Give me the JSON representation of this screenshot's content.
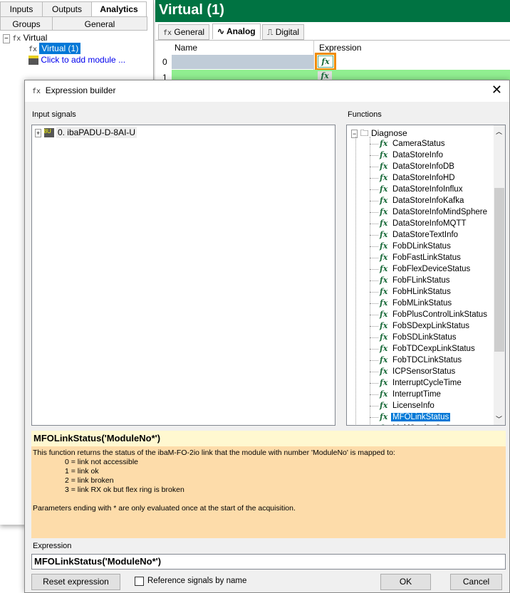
{
  "left_panel": {
    "tabs_row1": [
      "Inputs",
      "Outputs",
      "Analytics"
    ],
    "tabs_row2": [
      "Groups",
      "General"
    ],
    "tree": {
      "root": "Virtual",
      "child": "Virtual (1)",
      "add": "Click to add module ..."
    }
  },
  "right_panel": {
    "title": "Virtual (1)",
    "tabs": [
      "General",
      "Analog",
      "Digital"
    ],
    "columns": [
      "Name",
      "Expression"
    ],
    "rows": [
      "0",
      "1"
    ]
  },
  "dialog": {
    "title": "Expression builder",
    "input_signals_label": "Input signals",
    "input_signals": [
      "0. ibaPADU-D-8AI-U"
    ],
    "functions_label": "Functions",
    "function_group": "Diagnose",
    "functions": [
      "CameraStatus",
      "DataStoreInfo",
      "DataStoreInfoDB",
      "DataStoreInfoHD",
      "DataStoreInfoInflux",
      "DataStoreInfoKafka",
      "DataStoreInfoMindSphere",
      "DataStoreInfoMQTT",
      "DataStoreTextInfo",
      "FobDLinkStatus",
      "FobFastLinkStatus",
      "FobFlexDeviceStatus",
      "FobFLinkStatus",
      "FobHLinkStatus",
      "FobMLinkStatus",
      "FobPlusControlLinkStatus",
      "FobSDexpLinkStatus",
      "FobSDLinkStatus",
      "FobTDCexpLinkStatus",
      "FobTDCLinkStatus",
      "ICPSensorStatus",
      "InterruptCycleTime",
      "InterruptTime",
      "LicenseInfo",
      "MFOLinkStatus",
      "MultiStationStatus"
    ],
    "selected_function": "MFOLinkStatus",
    "help_title": "MFOLinkStatus('ModuleNo*')",
    "help_intro": "This function returns the status of the ibaM-FO-2io link that the module with number 'ModuleNo' is mapped to:",
    "help_values": [
      "0 = link not accessible",
      "1 = link ok",
      "2 = link broken",
      "3 = link RX ok but flex ring is broken"
    ],
    "help_note": "Parameters ending with * are only evaluated once at the start of the acquisition.",
    "expression_label": "Expression",
    "expression_value": "MFOLinkStatus('ModuleNo*')",
    "reset_button": "Reset expression",
    "reference_checkbox": "Reference signals by name",
    "reference_checked": false,
    "ok_button": "OK",
    "cancel_button": "Cancel"
  },
  "colors": {
    "header_green": "#007342",
    "selection": "#0078d7",
    "help_bg": "#fddcaa",
    "help_title_bg": "#fff8d0",
    "highlight": "#f08c00"
  }
}
